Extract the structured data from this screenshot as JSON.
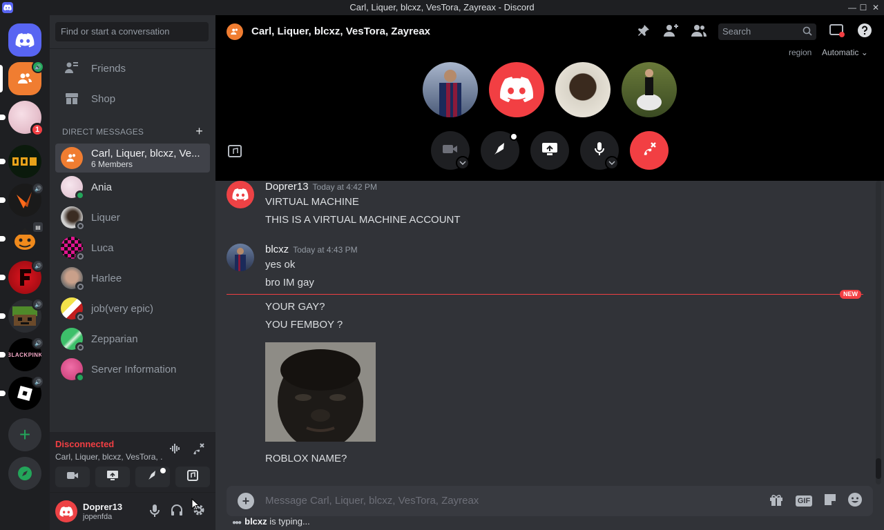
{
  "window": {
    "title": "Carl, Liquer, blcxz, VesTora, Zayreax - Discord",
    "min": "—",
    "max": "☐",
    "close": "✕"
  },
  "rail": {
    "badge_count": "1",
    "add_server": "+",
    "explore": "explore"
  },
  "sidebar": {
    "search_placeholder": "Find or start a conversation",
    "nav": [
      {
        "label": "Friends",
        "icon": "friends-icon"
      },
      {
        "label": "Shop",
        "icon": "shop-icon"
      }
    ],
    "dm_header": "DIRECT MESSAGES",
    "dm_add": "+",
    "dms": [
      {
        "name": "Carl, Liquer, blcxz, Ve...",
        "sub": "6 Members",
        "status_color": ""
      },
      {
        "name": "Ania",
        "status_color": "#23a55a"
      },
      {
        "name": "Liquer",
        "status_color": "#80848e"
      },
      {
        "name": "Luca",
        "status_color": "#80848e"
      },
      {
        "name": "Harlee",
        "status_color": "#80848e"
      },
      {
        "name": "job(very epic)",
        "status_color": "#80848e"
      },
      {
        "name": "Zepparian",
        "status_color": "#80848e"
      },
      {
        "name": "Server Information",
        "status_color": "#23a55a"
      }
    ]
  },
  "voice": {
    "status": "Disconnected",
    "channel": "Carl, Liquer, blcxz, VesTora, ..."
  },
  "user": {
    "name": "Doprer13",
    "tag": "jopenfda"
  },
  "header": {
    "title": "Carl, Liquer, blcxz, VesTora, Zayreax",
    "search_placeholder": "Search",
    "region_label": "region",
    "region_value": "Automatic ⌄"
  },
  "messages": {
    "group1": {
      "author": "Doprer13",
      "time": "Today at 4:42 PM",
      "lines": [
        "VIRTUAL MACHINE",
        "THIS IS A VIRTUAL MACHINE ACCOUNT"
      ]
    },
    "group2": {
      "author": "blcxz",
      "time": "Today at 4:43 PM",
      "lines": [
        "yes ok",
        "bro IM gay"
      ]
    },
    "new_label": "NEW",
    "cont": [
      "YOUR GAY?",
      "YOU FEMBOY ?"
    ],
    "after_image": "ROBLOX NAME?"
  },
  "composer": {
    "placeholder": "Message Carl, Liquer, blcxz, VesTora, Zayreax",
    "gif": "GIF"
  },
  "typing": {
    "who": "blcxz",
    "suffix": " is typing..."
  },
  "colors": {
    "accent": "#5865f2",
    "danger": "#f23f43",
    "online": "#23a55a",
    "offline": "#80848e",
    "group": "#f07d31"
  }
}
